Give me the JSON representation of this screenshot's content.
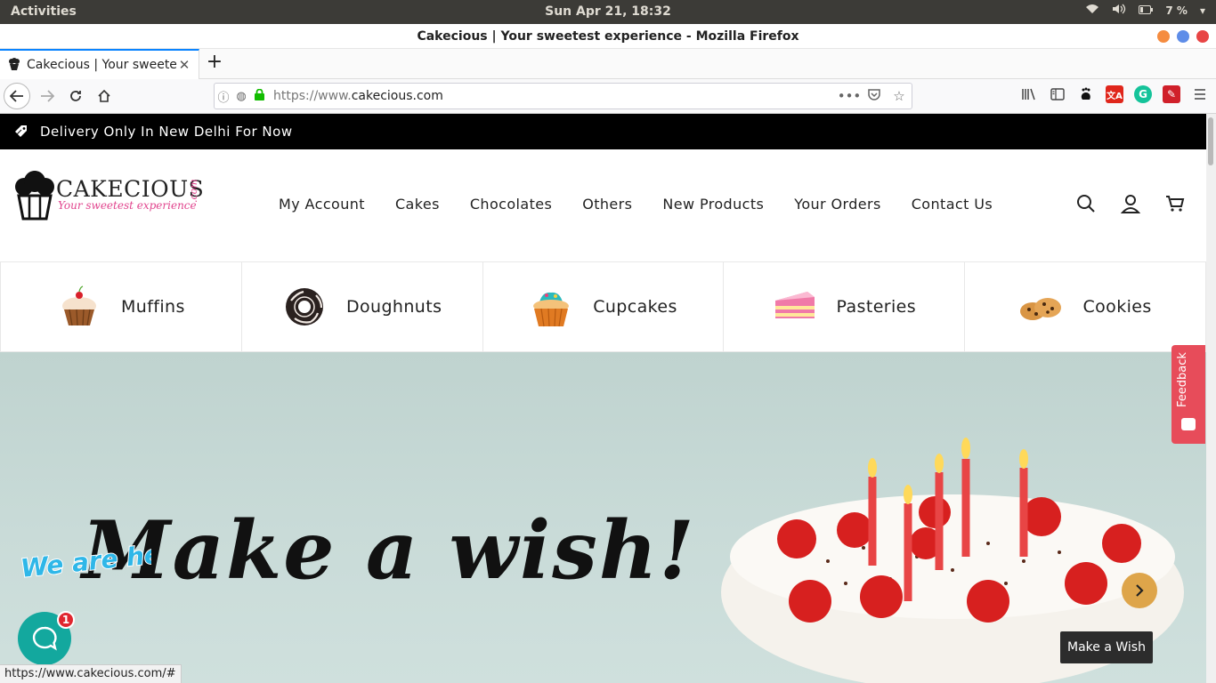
{
  "system_bar": {
    "activities": "Activities",
    "clock": "Sun Apr 21, 18:32",
    "battery": "7 %"
  },
  "window": {
    "title": "Cakecious | Your sweetest experience - Mozilla Firefox",
    "buttons": [
      "minimize",
      "maximize",
      "close"
    ]
  },
  "browser": {
    "tab_label": "Cakecious | Your sweetest experience",
    "url_prefix": "https://www.",
    "url_host": "cakecious.com",
    "status_url": "https://www.cakecious.com/#"
  },
  "site": {
    "announcement": "Delivery Only In New Delhi For Now",
    "logo_name": "CAKECIOUS",
    "logo_com": ".com",
    "logo_tagline": "Your sweetest experience",
    "nav": [
      "My Account",
      "Cakes",
      "Chocolates",
      "Others",
      "New Products",
      "Your Orders",
      "Contact Us"
    ],
    "categories": [
      {
        "label": "Muffins",
        "icon": "muffin-icon"
      },
      {
        "label": "Doughnuts",
        "icon": "doughnut-icon"
      },
      {
        "label": "Cupcakes",
        "icon": "cupcake-icon"
      },
      {
        "label": "Pasteries",
        "icon": "pastry-icon"
      },
      {
        "label": "Cookies",
        "icon": "cookies-icon"
      }
    ],
    "hero": {
      "headline": "Make a wish!",
      "tooltip": "Make a Wish"
    },
    "feedback_label": "Feedback",
    "chat_badge": "1",
    "chat_banner": "We are here!"
  },
  "colors": {
    "announcement_bg": "#000000",
    "hero_bg": "#c7d9d6",
    "accent_gold": "#dea54a",
    "feedback": "#e74c5a",
    "chat": "#13a89e",
    "logo_pink": "#e1458e"
  }
}
